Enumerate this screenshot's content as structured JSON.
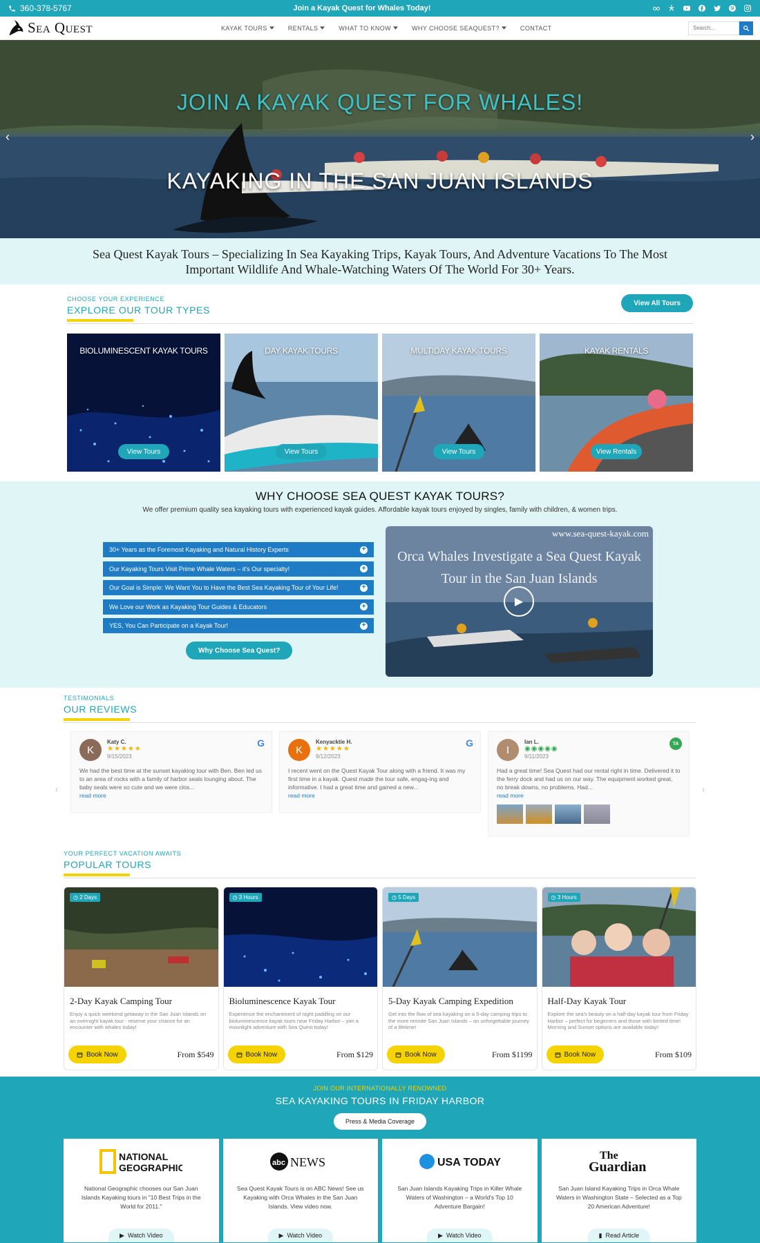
{
  "topbar": {
    "phone": "360-378-5767",
    "announcement": "Join a Kayak Quest for Whales Today!",
    "social_icons": [
      "tripadvisor-icon",
      "yelp-icon",
      "youtube-icon",
      "facebook-icon",
      "twitter-icon",
      "pinterest-icon",
      "instagram-icon"
    ]
  },
  "nav": {
    "logo_text": "Sea Quest",
    "menu": [
      {
        "label": "KAYAK TOURS",
        "has_dropdown": true
      },
      {
        "label": "RENTALS",
        "has_dropdown": true
      },
      {
        "label": "WHAT TO KNOW",
        "has_dropdown": true
      },
      {
        "label": "WHY CHOOSE SEAQUEST?",
        "has_dropdown": true
      },
      {
        "label": "CONTACT",
        "has_dropdown": false
      }
    ],
    "search_placeholder": "Search..."
  },
  "hero": {
    "headline": "JOIN A KAYAK QUEST FOR WHALES!",
    "subheadline": "KAYAKING IN THE SAN JUAN ISLANDS"
  },
  "tagline": "Sea Quest Kayak Tours – Specializing In Sea Kayaking Trips, Kayak Tours, And Adventure Vacations To The Most Important Wildlife And Whale-Watching Waters Of The World For 30+ Years.",
  "tour_types": {
    "eyebrow": "CHOOSE YOUR EXPERIENCE",
    "title": "EXPLORE OUR TOUR TYPES",
    "view_all_label": "View All Tours",
    "cards": [
      {
        "title": "BIOLUMINESCENT KAYAK TOURS",
        "button": "View Tours"
      },
      {
        "title": "DAY KAYAK TOURS",
        "button": "View Tours"
      },
      {
        "title": "MULTIDAY KAYAK TOURS",
        "button": "View Tours"
      },
      {
        "title": "KAYAK RENTALS",
        "button": "View Rentals"
      }
    ]
  },
  "why": {
    "title": "WHY CHOOSE SEA QUEST KAYAK TOURS?",
    "subtitle": "We offer premium quality sea kayaking tours with experienced kayak guides. Affordable kayak tours enjoyed by singles, family with children, & women trips.",
    "accordion": [
      "30+ Years as the Foremost Kayaking and Natural History Experts",
      "Our Kayaking Tours Visit Prime Whale Waters – it's Our specialty!",
      "Our Goal is Simple: We Want You to Have the Best Sea Kayaking Tour of Your Life!",
      "We Love our Work as Kayaking Tour Guides & Educators",
      "YES, You Can Participate on a Kayak Tour!"
    ],
    "cta_label": "Why Choose Sea Quest?",
    "video": {
      "url_text": "www.sea-quest-kayak.com",
      "title": "Orca Whales Investigate a Sea Quest Kayak Tour in the San Juan Islands"
    }
  },
  "reviews": {
    "eyebrow": "TESTIMONIALS",
    "title": "OUR REVIEWS",
    "items": [
      {
        "initial": "K",
        "name": "Katy C.",
        "stars": "★★★★★",
        "date": "9/15/2023",
        "text": "We had the best time at the sunset kayaking tour with Ben. Ben led us to an area of rocks with a family of harbor seals lounging about. The baby seals were so cute and we were clos...",
        "more": "read more",
        "source": "G",
        "color": "#8b6a5a"
      },
      {
        "initial": "K",
        "name": "Kenyacktie H.",
        "stars": "★★★★★",
        "date": "9/12/2023",
        "text": "I recent went on the Quest Kayak Tour along with a friend. It was my first time in a kayak. Quest made the tour safe, engag-ing and informative. I had a great time and gained a new...",
        "more": "read more",
        "source": "G",
        "color": "#e8700e"
      },
      {
        "initial": "I",
        "name": "Ian L.",
        "stars": "◉◉◉◉◉",
        "date": "9/11/2023",
        "text": "Had a great time! Sea Quest had our rental right in time. Delivered it to the ferry dock and had us on our way. The equipment worked great, no break downs, no problems. Had...",
        "more": "read more",
        "source": "TA",
        "color": "#b08d6e"
      }
    ]
  },
  "popular": {
    "eyebrow": "YOUR PERFECT VACATION AWAITS",
    "title": "POPULAR TOURS",
    "tours": [
      {
        "duration": "2 Days",
        "name": "2-Day Kayak Camping Tour",
        "desc": "Enjoy a quick weekend getaway in the San Juan Islands on an overnight kayak tour - reserve your chance for an encounter with whales today!",
        "book": "Book Now",
        "price": "From $549"
      },
      {
        "duration": "3 Hours",
        "name": "Bioluminescence Kayak Tour",
        "desc": "Experience the enchantment of night paddling on our bioluminescence kayak tours near Friday Harbor – join a moonlight adventure with Sea Quest today!",
        "book": "Book Now",
        "price": "From $129"
      },
      {
        "duration": "5 Days",
        "name": "5-Day Kayak Camping Expedition",
        "desc": "Get into the flow of sea kayaking on a 5-day camping trips to the more remote San Juan Islands – an unforgettable journey of a lifetime!",
        "book": "Book Now",
        "price": "From $1199"
      },
      {
        "duration": "3 Hours",
        "name": "Half-Day Kayak Tour",
        "desc": "Explore the sea's beauty on a half-day kayak tour from Friday Harbor – perfect for beginners and those with limited time! Morning and Sunset options are available today!",
        "book": "Book Now",
        "price": "From $109"
      }
    ]
  },
  "press": {
    "eyebrow": "JOIN OUR INTERNATIONALLY RENOWNED",
    "title": "SEA KAYAKING TOURS IN FRIDAY HARBOR",
    "button": "Press & Media Coverage",
    "cards": [
      {
        "logo": "NATIONAL GEOGRAPHIC",
        "text": "National Geographic chooses our San Juan Islands Kayaking tours in \"10 Best Trips in the World for 2011.\"",
        "action": "Watch Video"
      },
      {
        "logo": "abcNEWS",
        "text": "Sea Quest Kayak Tours is on ABC News! See us Kayaking with Orca Whales in the San Juan Islands. View video now.",
        "action": "Watch Video"
      },
      {
        "logo": "USA TODAY",
        "text": "San Juan Islands Kayaking Trips in Killer Whale Waters of Washington – a World's Top 10 Adventure Bargain!",
        "action": "Watch Video"
      },
      {
        "logo": "The Guardian",
        "text": "San Juan Island Kayaking Trips in Orca Whale Waters in Washington State – Selected as a Top 20 American Adventure!",
        "action": "Read Article"
      }
    ]
  },
  "colors": {
    "teal": "#1fa6b8",
    "blue": "#1e7bc4",
    "yellow": "#f5d300",
    "mint": "#e0f5f5"
  }
}
